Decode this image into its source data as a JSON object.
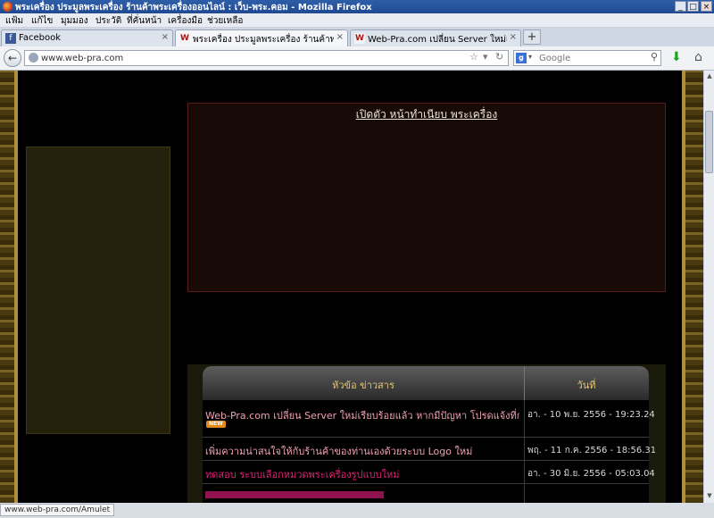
{
  "window": {
    "title": "พระเครื่อง ประมูลพระเครื่อง ร้านค้าพระเครื่องออนไลน์ : เว็บ-พระ.คอม - Mozilla Firefox",
    "controls": [
      "_",
      "□",
      "×"
    ]
  },
  "menu": [
    "แฟ้ม",
    "แก้ไข",
    "มุมมอง",
    "ประวัติ",
    "ที่คั่นหน้า",
    "เครื่องมือ",
    "ช่วยเหลือ"
  ],
  "tabs": [
    {
      "label": "Facebook",
      "favicon": "f"
    },
    {
      "label": "พระเครื่อง ประมูลพระเครื่อง ร้านค้าพระเครือ...",
      "favicon": "W"
    },
    {
      "label": "Web-Pra.com เปลี่ยน Server ใหม่เรียบร้อย...",
      "favicon": "W"
    }
  ],
  "nav": {
    "url": "www.web-pra.com",
    "search_placeholder": "Google",
    "new_tab": "+"
  },
  "page": {
    "greeting_link": "เปิดตัว หน้าทำเนียบ พระเครื่อง",
    "news_header": {
      "title": "หัวข้อ ข่าวสาร",
      "date": "วันที่"
    },
    "news_rows": [
      {
        "title": "Web-Pra.com เปลี่ยน Server ใหม่เรียบร้อยแล้ว หากมีปัญหา โปรดแจ้งที่กระทู้นี้",
        "date": "อา. - 10 พ.ย. 2556 - 19:23.24",
        "new": "NEW",
        "color": "#f0a0b0"
      },
      {
        "title": "เพิ่มความน่าสนใจให้กับร้านค้าของท่านเองด้วยระบบ Logo ใหม่",
        "date": "พฤ. - 11 ก.ค. 2556 - 18:56.31",
        "color": "#f0a0b0"
      },
      {
        "title": "ทดสอบ ระบบเลือกหมวดพระเครื่องรูปแบบใหม่",
        "date": "อา. - 30 มิ.ย. 2556 - 05:03.04",
        "color": "#e0207a"
      }
    ]
  },
  "status": "www.web-pra.com/Amulet",
  "colors": {
    "title_bar": "#1f4a92",
    "page_background": "#000000",
    "frame_gold": "#b08f3a",
    "news_header_text": "#e2c37a",
    "link_pink": "#e0207a"
  }
}
